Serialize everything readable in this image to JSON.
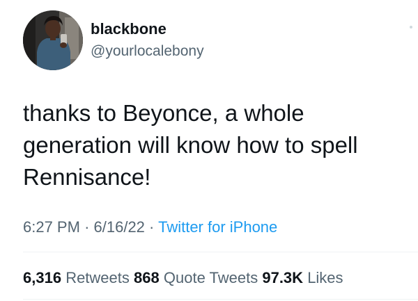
{
  "user": {
    "display_name": "blackbone",
    "handle": "@yourlocalebony"
  },
  "tweet": {
    "text_lines": [
      "thanks to Beyonce, a whole",
      "generation will know how to spell",
      "Rennisance!"
    ],
    "time": "6:27 PM",
    "separator": "·",
    "date": "6/16/22",
    "source": "Twitter for iPhone"
  },
  "stats": {
    "retweets_count": "6,316",
    "retweets_label": "Retweets",
    "quotes_count": "868",
    "quotes_label": "Quote Tweets",
    "likes_count": "97.3K",
    "likes_label": "Likes"
  },
  "colors": {
    "text": "#0f1419",
    "muted": "#536471",
    "link": "#1d9bf0",
    "divider": "#eff3f4"
  },
  "icons": {
    "more": "more-dot-icon"
  }
}
